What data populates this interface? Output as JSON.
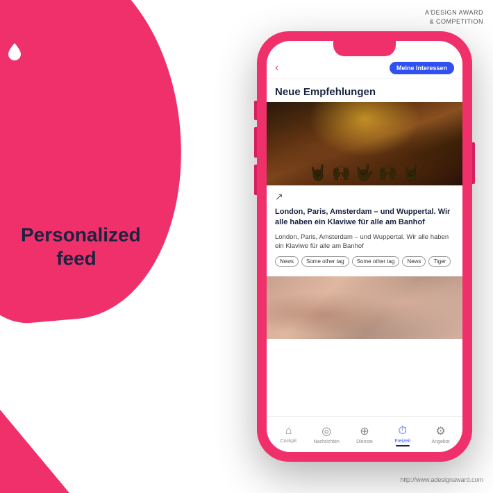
{
  "page": {
    "background_color": "#ffffff"
  },
  "award": {
    "line1": "A'DESIGN AWARD",
    "line2": "& COMPETITION"
  },
  "watermark": "http://www.adesignaward.com",
  "left_text": {
    "line1": "Personalized",
    "line2": "feed"
  },
  "phone": {
    "nav": {
      "back_label": "‹",
      "meine_button": "Meine Interessen"
    },
    "page_title": "Neue Empfehlungen",
    "article": {
      "title": "London, Paris, Amsterdam – und Wuppertal. Wir alle haben ein Klaviwe für alle am Banhof",
      "body": "London, Paris, Amsterdam – und Wuppertal. Wir alle haben ein Klaviwe für alle am Banhof",
      "tags": [
        "News",
        "Some other tag",
        "Some other tag",
        "News",
        "Tiger"
      ]
    },
    "bottom_nav": [
      {
        "label": "Cockpit",
        "icon": "⌂",
        "active": false
      },
      {
        "label": "Nachrichten",
        "icon": "◎",
        "active": false
      },
      {
        "label": "Dienste",
        "icon": "⊕",
        "active": false
      },
      {
        "label": "Freizeit",
        "icon": "⏱",
        "active": true
      },
      {
        "label": "Angebot",
        "icon": "⚙",
        "active": false
      }
    ]
  }
}
